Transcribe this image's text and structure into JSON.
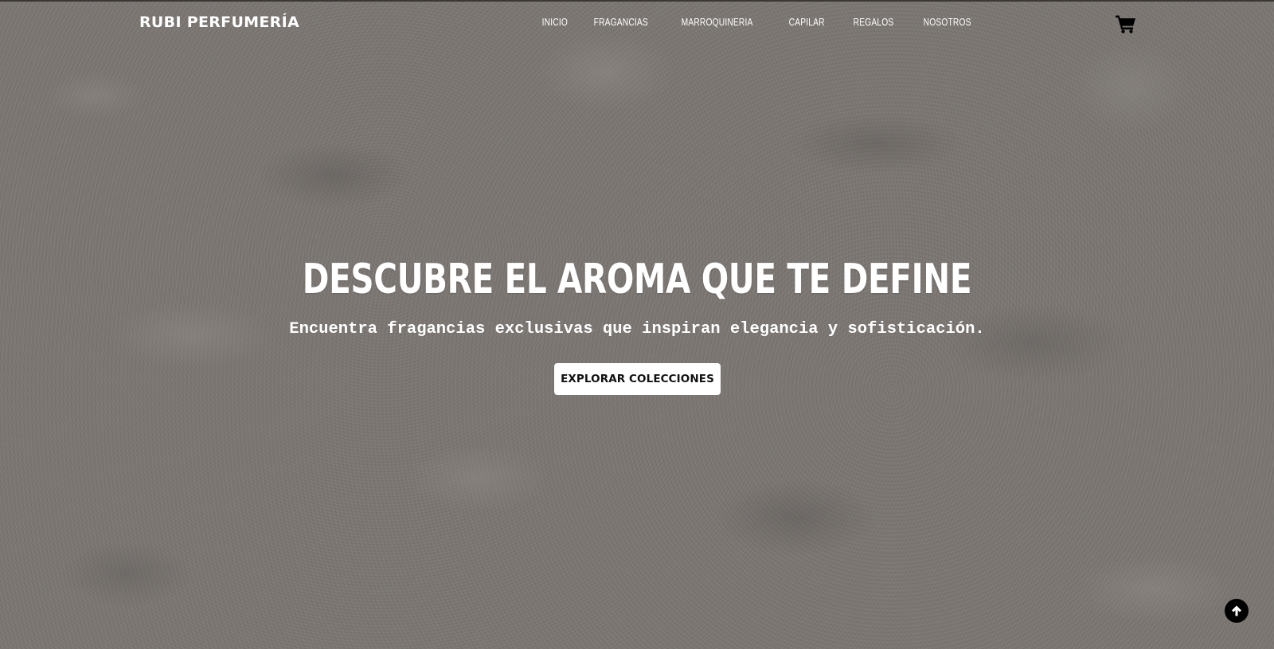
{
  "header": {
    "brand": "RUBI PERFUMERÍA",
    "nav": [
      {
        "label": "INICIO"
      },
      {
        "label": "FRAGANCIAS"
      },
      {
        "label": "MARROQUINERIA"
      },
      {
        "label": "CAPILAR"
      },
      {
        "label": "REGALOS"
      },
      {
        "label": "NOSOTROS"
      }
    ],
    "cart_icon": "shopping-cart-icon"
  },
  "hero": {
    "title": "DESCUBRE EL AROMA QUE TE DEFINE",
    "subtitle": "Encuentra fragancias exclusivas que inspiran elegancia y sofisticación.",
    "cta_label": "EXPLORAR COLECCIONES"
  },
  "scroll_top": {
    "icon": "arrow-up-icon"
  },
  "colors": {
    "background": "#7b7672",
    "text": "#ffffff",
    "button_bg": "#ffffff",
    "button_text": "#111111",
    "scroll_button_bg": "#000000"
  }
}
